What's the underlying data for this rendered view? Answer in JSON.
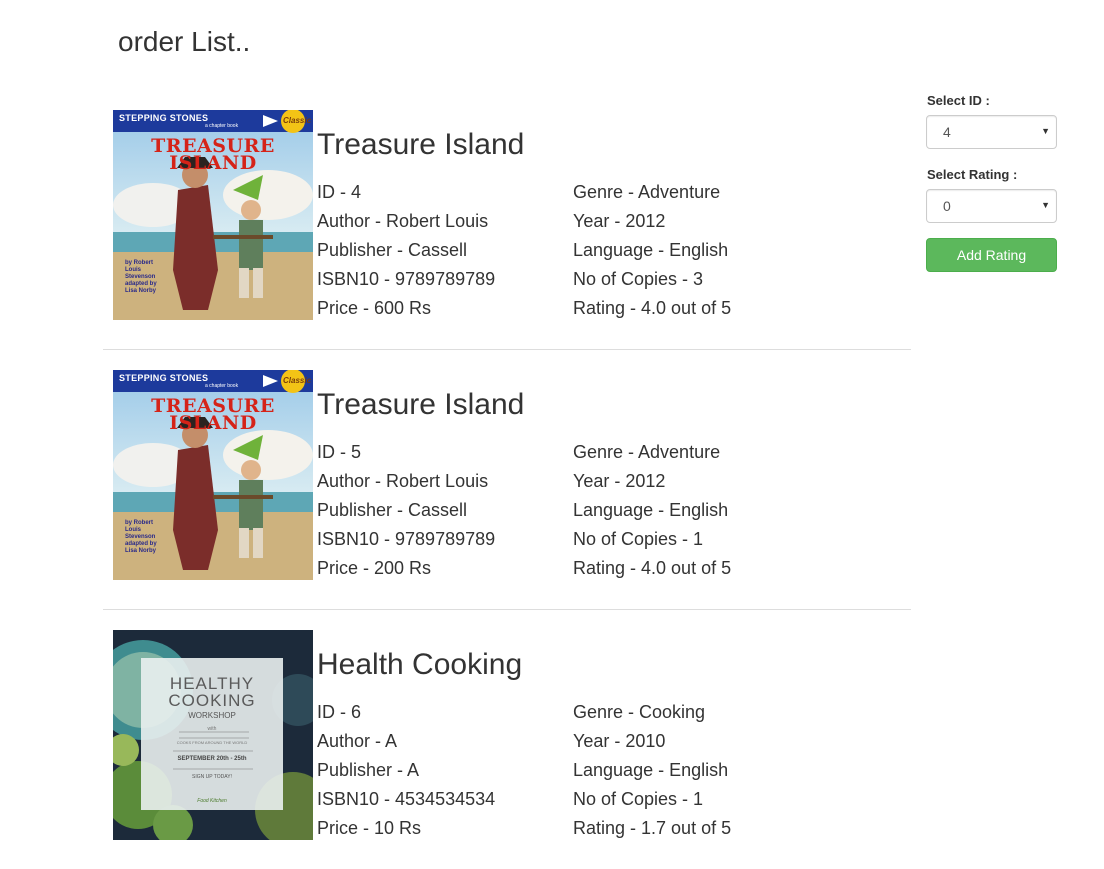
{
  "page": {
    "heading": "order List.."
  },
  "books": [
    {
      "title": "Treasure Island",
      "id": "ID - 4",
      "author": "Author - Robert Louis",
      "publisher": "Publisher - Cassell",
      "isbn": "ISBN10 - 9789789789",
      "price": "Price - 600 Rs",
      "genre": "Genre - Adventure",
      "year": "Year - 2012",
      "language": "Language - English",
      "copies": "No of Copies - 3",
      "rating": "Rating - 4.0 out of 5",
      "cover": {
        "series": "STEPPING STONES",
        "subtitle": "a chapter book",
        "badge": "Classic",
        "title_line1": "TREASURE",
        "title_line2": "ISLAND",
        "credits": "by Robert Louis Stevenson adapted by Lisa Norby"
      }
    },
    {
      "title": "Treasure Island",
      "id": "ID - 5",
      "author": "Author - Robert Louis",
      "publisher": "Publisher - Cassell",
      "isbn": "ISBN10 - 9789789789",
      "price": "Price - 200 Rs",
      "genre": "Genre - Adventure",
      "year": "Year - 2012",
      "language": "Language - English",
      "copies": "No of Copies - 1",
      "rating": "Rating - 4.0 out of 5",
      "cover": {
        "series": "STEPPING STONES",
        "subtitle": "a chapter book",
        "badge": "Classic",
        "title_line1": "TREASURE",
        "title_line2": "ISLAND",
        "credits": "by Robert Louis Stevenson adapted by Lisa Norby"
      }
    },
    {
      "title": "Health Cooking",
      "id": "ID - 6",
      "author": "Author - A",
      "publisher": "Publisher - A",
      "isbn": "ISBN10 - 4534534534",
      "price": "Price - 10 Rs",
      "genre": "Genre - Cooking",
      "year": "Year - 2010",
      "language": "Language - English",
      "copies": "No of Copies - 1",
      "rating": "Rating - 1.7 out of 5",
      "cover": {
        "line1": "HEALTHY",
        "line2": "COOKING",
        "line3": "WORKSHOP",
        "with": "with",
        "tagline": "COOKS FROM AROUND THE WORLD",
        "dates": "SEPTEMBER 20th - 25th",
        "cta": "SIGN UP TODAY!",
        "signature": "Food Kitchen"
      }
    }
  ],
  "sidebar": {
    "select_id_label": "Select ID :",
    "select_id_value": "4",
    "select_rating_label": "Select Rating :",
    "select_rating_value": "0",
    "add_rating_label": "Add Rating"
  },
  "colors": {
    "button_bg": "#5cb85c",
    "button_border": "#4cae4c",
    "text": "#333333",
    "divider": "#dddddd"
  },
  "icons": {
    "select_caret": "caret-down-icon"
  }
}
